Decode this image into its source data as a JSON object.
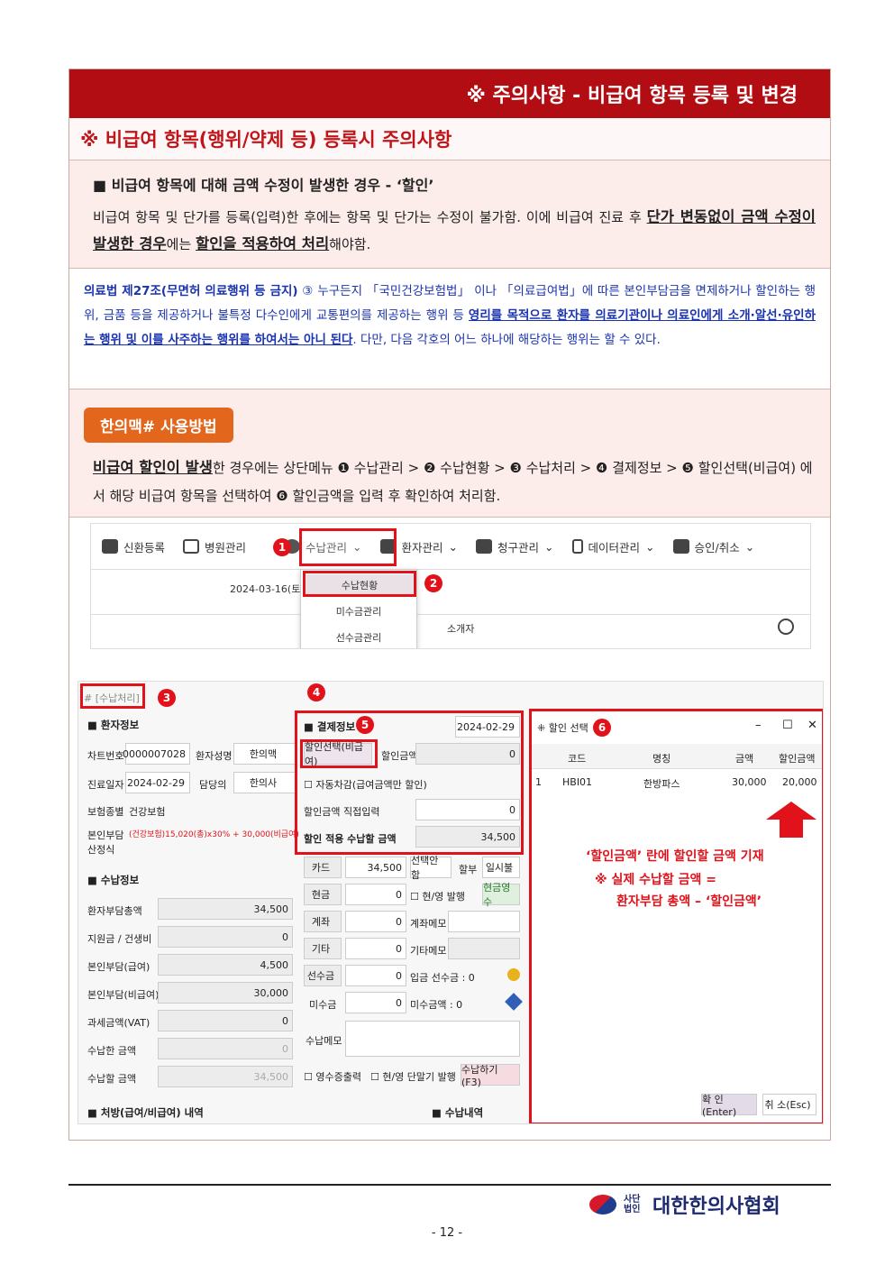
{
  "title": "※ 주의사항 - 비급여 항목 등록 및 변경",
  "subtitle": "※ 비급여 항목(행위/약제 등) 등록시 주의사항",
  "section1": {
    "heading": "■ 비급여 항목에 대해 금액 수정이 발생한 경우 - ‘할인’",
    "p1": "비급여 항목 및 단가를 등록(입력)한 후에는 항목 및 단가는 수정이 불가함. 이에 비급여 진료 후 ",
    "p1b": "단가 변동없이 금액 수정이 발생한 경우",
    "p1c": "에는 ",
    "p1d": "할인을 적용하여 처리",
    "p1e": "해야함."
  },
  "section2": {
    "a": "의료법 제27조(무면허 의료행위 등 금지)",
    "b": " ③ 누구든지 「국민건강보험법」 이나 「의료급여법」에 따른 본인부담금을 면제하거나 할인하는 행위, 금품 등을 제공하거나 불특정 다수인에게 교통편의를 제공하는 행위 등 ",
    "c": "영리를 목적으로 환자를 의료기관이나 의료인에게 소개·알선·유인하는 행위 및 이를 사주하는 행위를 하여서는 아니 된다",
    "d": ". 다만, 다음 각호의 어느 하나에 해당하는 행위는 할 수 있다."
  },
  "section3": {
    "badge": "한의맥# 사용방법",
    "a": "비급여 할인이 발생",
    "b": "한 경우에는 상단메뉴 ❶ 수납관리 > ❷ 수납현황 > ❸ 수납처리 > ❹ 결제정보 > ❺ 할인선택(비급여) 에서 해당 비급여 항목을 선택하여 ❻ 할인금액을 입력 후 확인하여 처리함."
  },
  "nav": {
    "items": [
      "신환등록",
      "병원관리",
      "수납관리",
      "환자관리",
      "청구관리",
      "데이터관리",
      "승인/취소"
    ],
    "date": "2024-03-16(토)",
    "dropdown": [
      "수납현황",
      "미수금관리",
      "선수금관리"
    ],
    "tab": "소개자"
  },
  "patient": {
    "header": "■ 환자정보",
    "chart_no_label": "차트번호",
    "chart_no": "0000007028",
    "name_label": "환자성명",
    "name": "한의맥",
    "date_label": "진료일자",
    "date": "2024-02-29",
    "doctor_label": "담당의",
    "doctor": "한의사",
    "ins_label": "보험종별",
    "ins": "건강보험",
    "calc_label": "본인부담 산정식",
    "calc": "(건강보험)15,020(총)x30% + 30,000(비급여)"
  },
  "payinfo": {
    "header": "■ 수납정보",
    "rows": [
      [
        "환자부담총액",
        "34,500"
      ],
      [
        "지원금 / 건생비",
        "0"
      ],
      [
        "본인부담(급여)",
        "4,500"
      ],
      [
        "본인부담(비급여)",
        "30,000"
      ],
      [
        "과세금액(VAT)",
        "0"
      ],
      [
        "수납한 금액",
        "0"
      ],
      [
        "수납할 금액",
        "34,500"
      ]
    ]
  },
  "payment": {
    "header": "■ 결제정보",
    "date": "2024-02-29",
    "discount_btn": "할인선택(비급여)",
    "discount_label": "할인금액",
    "discount_val": "0",
    "auto": "자동차감(급여금액만 할인)",
    "direct": "할인금액 직접입력",
    "direct_val": "0",
    "after": "할인 적용 수납할 금액",
    "after_val": "34,500",
    "card": "카드",
    "card_val": "34,500",
    "card_sel": "선택안함",
    "installment": "할부",
    "lump": "일시불",
    "cash": "현금",
    "cash_val": "0",
    "cash_chk": "현/영 발행",
    "cash_receipt": "현금영수",
    "transfer": "계좌",
    "transfer_val": "0",
    "transfer_memo": "계좌메모",
    "other": "기타",
    "other_val": "0",
    "other_memo": "기타메모",
    "prepaid": "선수금",
    "prepaid_val": "0",
    "prepaid_in": "입금 선수금 : 0",
    "unpaid": "미수금",
    "unpaid_val": "0",
    "unpaid_cnt": "미수금액 : 0",
    "memo": "수납메모",
    "receipt": "영수증출력",
    "cash_term": "현/영 단말기 발행",
    "pay_btn": "수납하기(F3)"
  },
  "window": {
    "title": "할인 선택",
    "cols": [
      "코드",
      "명칭",
      "금액",
      "할인금액"
    ],
    "row": [
      "1",
      "HBI01",
      "한방파스",
      "30,000",
      "20,000"
    ],
    "ok": "확 인(Enter)",
    "cancel": "취 소(Esc)"
  },
  "tab_label": "[수납처리]",
  "rx": "■ 처방(급여/비급여) 내역",
  "paylist": "■ 수납내역",
  "note": [
    "‘할인금액’ 란에 할인할 금액 기재",
    "※ 실제 수납할 금액 =",
    "환자부담 총액 – ‘할인금액’"
  ],
  "footer": {
    "org_small": "사단법인",
    "org": "대한한의사협회",
    "page": "- 12 -"
  },
  "markers": [
    "1",
    "2",
    "3",
    "4",
    "5",
    "6"
  ]
}
